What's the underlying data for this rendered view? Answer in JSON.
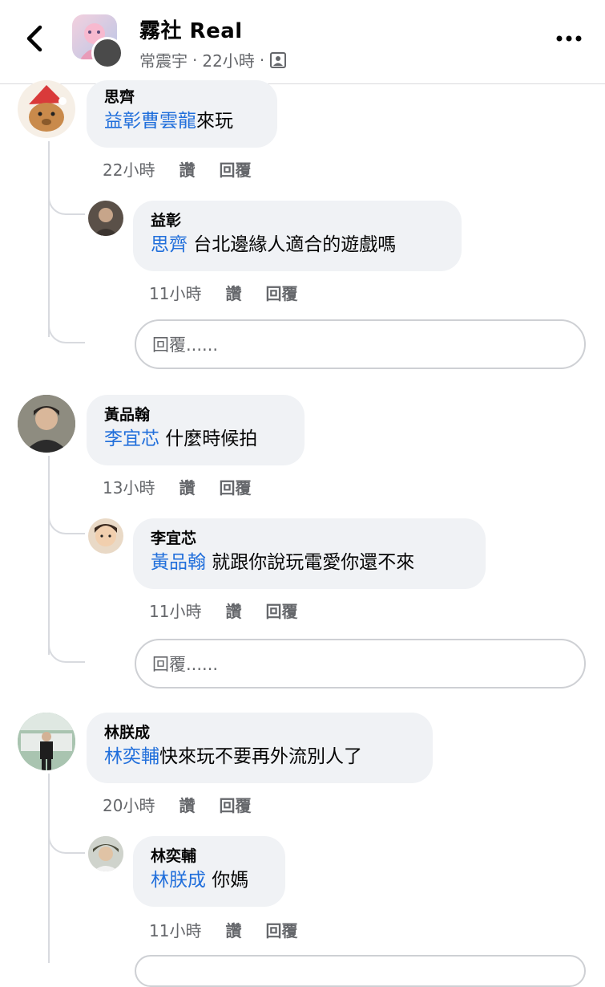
{
  "header": {
    "title": "霧社 Real",
    "author": "常震宇",
    "time": "22小時",
    "dot": "·"
  },
  "comments": [
    {
      "name": "思齊",
      "mention": "益彰曹雲龍",
      "text": "來玩",
      "time": "22小時",
      "like": "讚",
      "reply": "回覆",
      "reply_item": {
        "name": "益彰",
        "mention": "思齊",
        "text": " 台北邊緣人適合的遊戲嗎",
        "time": "11小時",
        "like": "讚",
        "reply": "回覆"
      }
    },
    {
      "name": "黃品翰",
      "mention": "李宜芯",
      "text": " 什麼時候拍",
      "time": "13小時",
      "like": "讚",
      "reply": "回覆",
      "reply_item": {
        "name": "李宜芯",
        "mention": "黃品翰",
        "text": " 就跟你說玩電愛你還不來",
        "time": "11小時",
        "like": "讚",
        "reply": "回覆"
      }
    },
    {
      "name": "林朕成",
      "mention": "林奕輔",
      "text": "快來玩不要再外流別人了",
      "time": "20小時",
      "like": "讚",
      "reply": "回覆",
      "reply_item": {
        "name": "林奕輔",
        "mention": "林朕成",
        "text": " 你媽",
        "time": "11小時",
        "like": "讚",
        "reply": "回覆"
      }
    }
  ],
  "reply_placeholder": "回覆......",
  "icons": {
    "back": "chevron-left-icon",
    "more": "more-horizontal-icon",
    "audience": "group-audience-icon"
  },
  "colors": {
    "mention": "#216fdb",
    "bubble": "#f0f2f5",
    "meta": "#65676b"
  }
}
